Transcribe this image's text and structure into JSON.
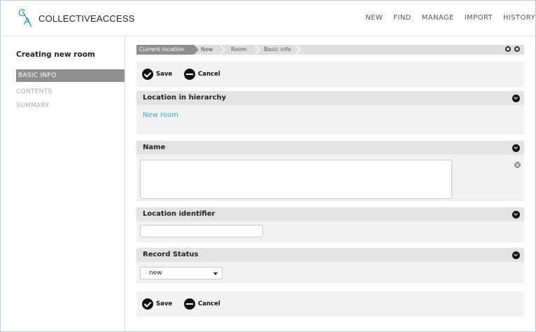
{
  "header": {
    "logo_text": "COLLECTIVEACCESS",
    "logo_mark_c": "C",
    "logo_mark_a": "A",
    "nav": [
      "NEW",
      "FIND",
      "MANAGE",
      "IMPORT",
      "HISTORY"
    ]
  },
  "sidebar": {
    "title": "Creating new room",
    "items": [
      {
        "label": "BASIC INFO",
        "active": true
      },
      {
        "label": "CONTENTS",
        "active": false
      },
      {
        "label": "SUMMARY",
        "active": false
      }
    ]
  },
  "breadcrumb": [
    "Current location",
    "New",
    "Room",
    "Basic info"
  ],
  "toolbar": {
    "save_label": "Save",
    "cancel_label": "Cancel"
  },
  "sections": {
    "location": {
      "title": "Location in hierarchy",
      "link": "New room"
    },
    "name": {
      "title": "Name",
      "value": ""
    },
    "identifier": {
      "title": "Location identifier",
      "value": ""
    },
    "status": {
      "title": "Record Status",
      "selected": "new"
    }
  }
}
